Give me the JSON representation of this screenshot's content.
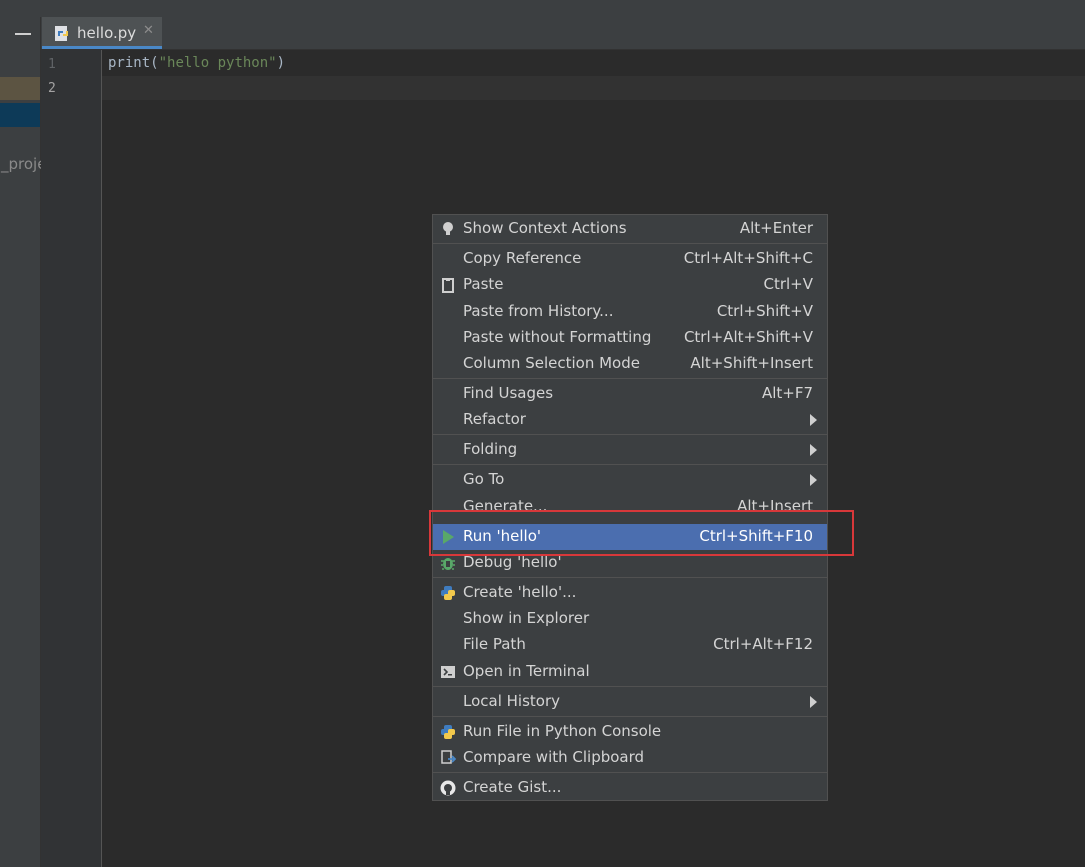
{
  "editor": {
    "tab": {
      "label": "hello.py",
      "close": "✕"
    },
    "line_numbers": [
      "1",
      "2"
    ],
    "code": {
      "fn": "print",
      "open": "(",
      "str": "\"hello python\"",
      "close": ")"
    },
    "left_panel_text": "_proje"
  },
  "menu": {
    "items": [
      {
        "label": "Show Context Actions",
        "shortcut": "Alt+Enter",
        "icon": "lightbulb-icon"
      },
      {
        "label": "Copy Reference",
        "shortcut": "Ctrl+Alt+Shift+C"
      },
      {
        "label": "Paste",
        "shortcut": "Ctrl+V",
        "icon": "clipboard-icon"
      },
      {
        "label": "Paste from History...",
        "shortcut": "Ctrl+Shift+V"
      },
      {
        "label": "Paste without Formatting",
        "shortcut": "Ctrl+Alt+Shift+V"
      },
      {
        "label": "Column Selection Mode",
        "shortcut": "Alt+Shift+Insert"
      },
      {
        "label": "Find Usages",
        "shortcut": "Alt+F7"
      },
      {
        "label": "Refactor",
        "submenu": true
      },
      {
        "label": "Folding",
        "submenu": true
      },
      {
        "label": "Go To",
        "submenu": true
      },
      {
        "label": "Generate...",
        "shortcut": "Alt+Insert"
      },
      {
        "label": "Run 'hello'",
        "shortcut": "Ctrl+Shift+F10",
        "icon": "run-icon",
        "selected": true
      },
      {
        "label": "Debug 'hello'",
        "icon": "debug-icon"
      },
      {
        "label": "Create 'hello'...",
        "icon": "python-icon"
      },
      {
        "label": "Show in Explorer"
      },
      {
        "label": "File Path",
        "shortcut": "Ctrl+Alt+F12"
      },
      {
        "label": "Open in Terminal",
        "icon": "terminal-icon"
      },
      {
        "label": "Local History",
        "submenu": true
      },
      {
        "label": "Run File in Python Console",
        "icon": "python-console-icon"
      },
      {
        "label": "Compare with Clipboard",
        "icon": "compare-icon"
      },
      {
        "label": "Create Gist...",
        "icon": "github-icon"
      }
    ]
  },
  "colors": {
    "selection": "#4b6eaf",
    "highlight_box": "#d8383a"
  }
}
